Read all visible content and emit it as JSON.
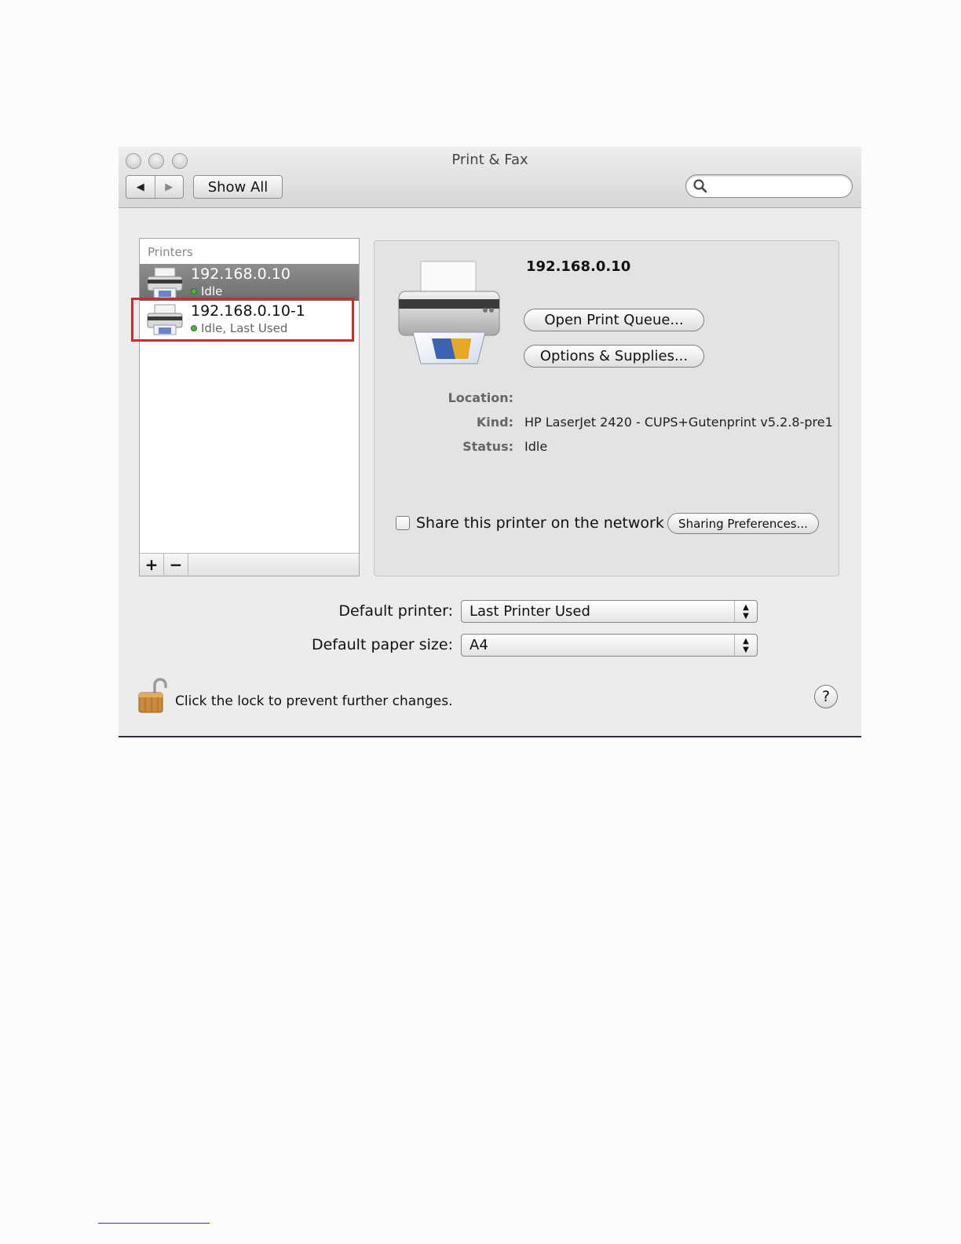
{
  "window": {
    "title": "Print & Fax"
  },
  "toolbar": {
    "back": "◀",
    "forward": "▶",
    "show_all": "Show All",
    "search_placeholder": ""
  },
  "printers": {
    "header": "Printers",
    "items": [
      {
        "name": "192.168.0.10",
        "status": "Idle",
        "selected": true
      },
      {
        "name": "192.168.0.10-1",
        "status": "Idle, Last Used",
        "selected": false
      }
    ],
    "add": "+",
    "remove": "−"
  },
  "detail": {
    "name": "192.168.0.10",
    "open_queue": "Open Print Queue...",
    "options": "Options & Supplies...",
    "location_label": "Location:",
    "location_value": "",
    "kind_label": "Kind:",
    "kind_value": "HP LaserJet 2420 - CUPS+Gutenprint v5.2.8-pre1",
    "status_label": "Status:",
    "status_value": "Idle",
    "share_label": "Share this printer on the network",
    "sharing_prefs": "Sharing Preferences..."
  },
  "defaults": {
    "printer_label": "Default printer:",
    "printer_value": "Last Printer Used",
    "paper_label": "Default paper size:",
    "paper_value": "A4"
  },
  "footer": {
    "lock_text": "Click the lock to prevent further changes.",
    "help": "?"
  },
  "colors": {
    "highlight": "#cf2a2f",
    "status_dot": "#55b23b",
    "selection": "#7a7a7a"
  }
}
